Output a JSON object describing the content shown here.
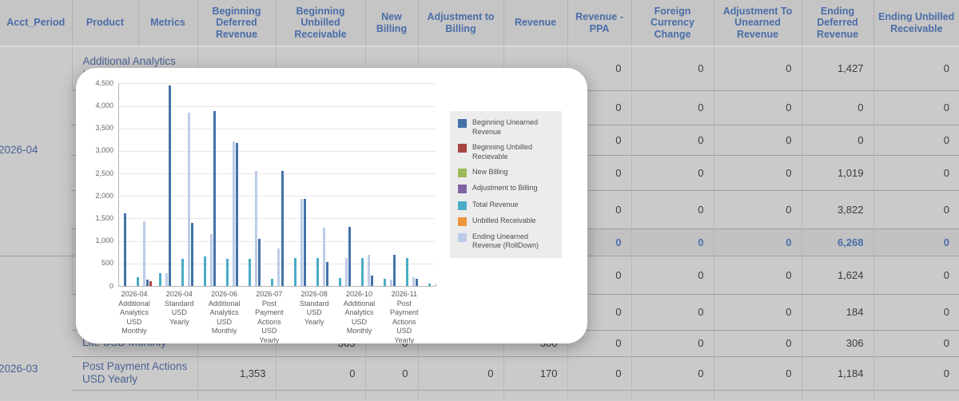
{
  "table": {
    "columns": [
      {
        "label": "Acct_Period"
      },
      {
        "label": "Product"
      },
      {
        "label": "Metrics"
      },
      {
        "label": "Beginning Deferred Revenue"
      },
      {
        "label": "Beginning Unbilled Receivable"
      },
      {
        "label": "New Billing"
      },
      {
        "label": "Adjustment to Billing"
      },
      {
        "label": "Revenue"
      },
      {
        "label": "Revenue - PPA"
      },
      {
        "label": "Foreign Currency Change"
      },
      {
        "label": "Adjustment To Unearned Revenue"
      },
      {
        "label": "Ending Deferred Revenue"
      },
      {
        "label": "Ending Unbilled Receivable"
      }
    ],
    "groups": [
      {
        "period": "2026-04"
      },
      {
        "period": "2026-03"
      }
    ],
    "rows": [
      {
        "group": 0,
        "group_rows": 6,
        "product": "Additional Analytics USD Monthly",
        "total": false,
        "cells": {
          "beg_def": "",
          "beg_unb": "",
          "new_bill": "",
          "adj_bill": "",
          "revenue": "",
          "ppa": "0",
          "fcc": "0",
          "adj_unearned": "0",
          "end_def": "1,427",
          "end_unb": "0"
        }
      },
      {
        "total": false,
        "product": "",
        "cells": {
          "beg_def": "",
          "beg_unb": "",
          "new_bill": "",
          "adj_bill": "",
          "revenue": "",
          "ppa": "0",
          "fcc": "0",
          "adj_unearned": "0",
          "end_def": "0",
          "end_unb": "0"
        }
      },
      {
        "total": false,
        "product": "",
        "cells": {
          "beg_def": "",
          "beg_unb": "",
          "new_bill": "",
          "adj_bill": "",
          "revenue": "",
          "ppa": "0",
          "fcc": "0",
          "adj_unearned": "0",
          "end_def": "0",
          "end_unb": "0"
        }
      },
      {
        "total": false,
        "product": "",
        "cells": {
          "beg_def": "",
          "beg_unb": "",
          "new_bill": "",
          "adj_bill": "",
          "revenue": "",
          "ppa": "0",
          "fcc": "0",
          "adj_unearned": "0",
          "end_def": "1,019",
          "end_unb": "0"
        }
      },
      {
        "total": false,
        "product": "",
        "cells": {
          "beg_def": "",
          "beg_unb": "",
          "new_bill": "",
          "adj_bill": "",
          "revenue": "",
          "ppa": "0",
          "fcc": "0",
          "adj_unearned": "0",
          "end_def": "3,822",
          "end_unb": "0"
        }
      },
      {
        "total": true,
        "product": "",
        "cells": {
          "beg_def": "",
          "beg_unb": "",
          "new_bill": "",
          "adj_bill": "",
          "revenue": "",
          "ppa": "0",
          "fcc": "0",
          "adj_unearned": "0",
          "end_def": "6,268",
          "end_unb": "0"
        }
      },
      {
        "group": 1,
        "group_rows": 5,
        "product": "",
        "total": false,
        "cells": {
          "beg_def": "",
          "beg_unb": "",
          "new_bill": "",
          "adj_bill": "",
          "revenue": "",
          "ppa": "0",
          "fcc": "0",
          "adj_unearned": "0",
          "end_def": "1,624",
          "end_unb": "0"
        }
      },
      {
        "total": false,
        "product": "",
        "cells": {
          "beg_def": "",
          "beg_unb": "",
          "new_bill": "",
          "adj_bill": "",
          "revenue": "",
          "ppa": "0",
          "fcc": "0",
          "adj_unearned": "0",
          "end_def": "184",
          "end_unb": "0"
        }
      },
      {
        "total": false,
        "product": "Lite USD Monthly",
        "cells": {
          "beg_def": "",
          "beg_unb": "363",
          "new_bill": "0",
          "adj_bill": "",
          "revenue": "300",
          "ppa": "0",
          "fcc": "0",
          "adj_unearned": "0",
          "end_def": "306",
          "end_unb": "0"
        }
      },
      {
        "total": false,
        "product": "Post Payment Actions USD Yearly",
        "cells": {
          "beg_def": "1,353",
          "beg_unb": "0",
          "new_bill": "0",
          "adj_bill": "0",
          "revenue": "170",
          "ppa": "0",
          "fcc": "0",
          "adj_unearned": "0",
          "end_def": "1,184",
          "end_unb": "0"
        }
      },
      {
        "total": false,
        "product": "",
        "cells": {
          "beg_def": "",
          "beg_unb": "",
          "new_bill": "",
          "adj_bill": "",
          "revenue": "",
          "ppa": "",
          "fcc": "",
          "adj_unearned": "",
          "end_def": "",
          "end_unb": ""
        }
      }
    ]
  },
  "popup": {
    "chart_data": {
      "type": "bar",
      "title": "",
      "ylim": [
        0,
        4500
      ],
      "ytick_step": 500,
      "y_ticks": [
        "0",
        "500",
        "1,000",
        "1,500",
        "2,000",
        "2,500",
        "3,000",
        "3,500",
        "4,000",
        "4,500"
      ],
      "grid": true,
      "legend_position": "right",
      "categories": [
        {
          "lines": [
            "2026-04",
            "Additional",
            "Analytics",
            "USD",
            "Monthly"
          ]
        },
        {
          "lines": []
        },
        {
          "lines": [
            "2026-04",
            "Standard",
            "USD",
            "Yearly"
          ]
        },
        {
          "lines": []
        },
        {
          "lines": [
            "2026-06",
            "Additional",
            "Analytics",
            "USD",
            "Monthly"
          ]
        },
        {
          "lines": []
        },
        {
          "lines": [
            "2026-07",
            "Post",
            "Payment",
            "Actions",
            "USD",
            "Yearly"
          ]
        },
        {
          "lines": []
        },
        {
          "lines": [
            "2026-08",
            "Standard",
            "USD",
            "Yearly"
          ]
        },
        {
          "lines": []
        },
        {
          "lines": [
            "2026-10",
            "Additional",
            "Analytics",
            "USD",
            "Monthly"
          ]
        },
        {
          "lines": []
        },
        {
          "lines": [
            "2026-11",
            "Post",
            "Payment",
            "Actions",
            "USD",
            "Yearly"
          ]
        },
        {
          "lines": []
        }
      ],
      "series": [
        {
          "name": "Beginning Unearned Revenue",
          "color": "#4472A8",
          "values": [
            1620,
            140,
            4450,
            1410,
            3880,
            3180,
            1050,
            2560,
            1940,
            530,
            1310,
            230,
            690,
            165
          ]
        },
        {
          "name": "Beginning Unbilled Recievable",
          "color": "#A94442",
          "values": [
            0,
            110,
            0,
            0,
            0,
            0,
            0,
            0,
            0,
            0,
            0,
            0,
            0,
            0
          ]
        },
        {
          "name": "New Billing",
          "color": "#9BBB59",
          "values": [
            0,
            0,
            0,
            0,
            0,
            0,
            0,
            0,
            0,
            0,
            0,
            0,
            0,
            0
          ]
        },
        {
          "name": "Adjustment to Billing",
          "color": "#8064A2",
          "values": [
            0,
            0,
            0,
            0,
            0,
            0,
            0,
            0,
            0,
            0,
            0,
            0,
            0,
            0
          ]
        },
        {
          "name": "Total Revenue",
          "color": "#4BACC6",
          "values": [
            190,
            290,
            610,
            650,
            600,
            600,
            160,
            630,
            630,
            180,
            620,
            165,
            630,
            60
          ]
        },
        {
          "name": "Unbilled Receivable",
          "color": "#F0953F",
          "values": [
            0,
            0,
            0,
            0,
            0,
            0,
            0,
            0,
            0,
            0,
            0,
            0,
            0,
            0
          ]
        },
        {
          "name": "Ending Unearned Revenue (RollDown)",
          "color": "#BCCCE8",
          "values": [
            1430,
            290,
            3850,
            1160,
            3220,
            2560,
            840,
            1940,
            1290,
            630,
            690,
            150,
            200,
            40
          ]
        }
      ]
    }
  }
}
